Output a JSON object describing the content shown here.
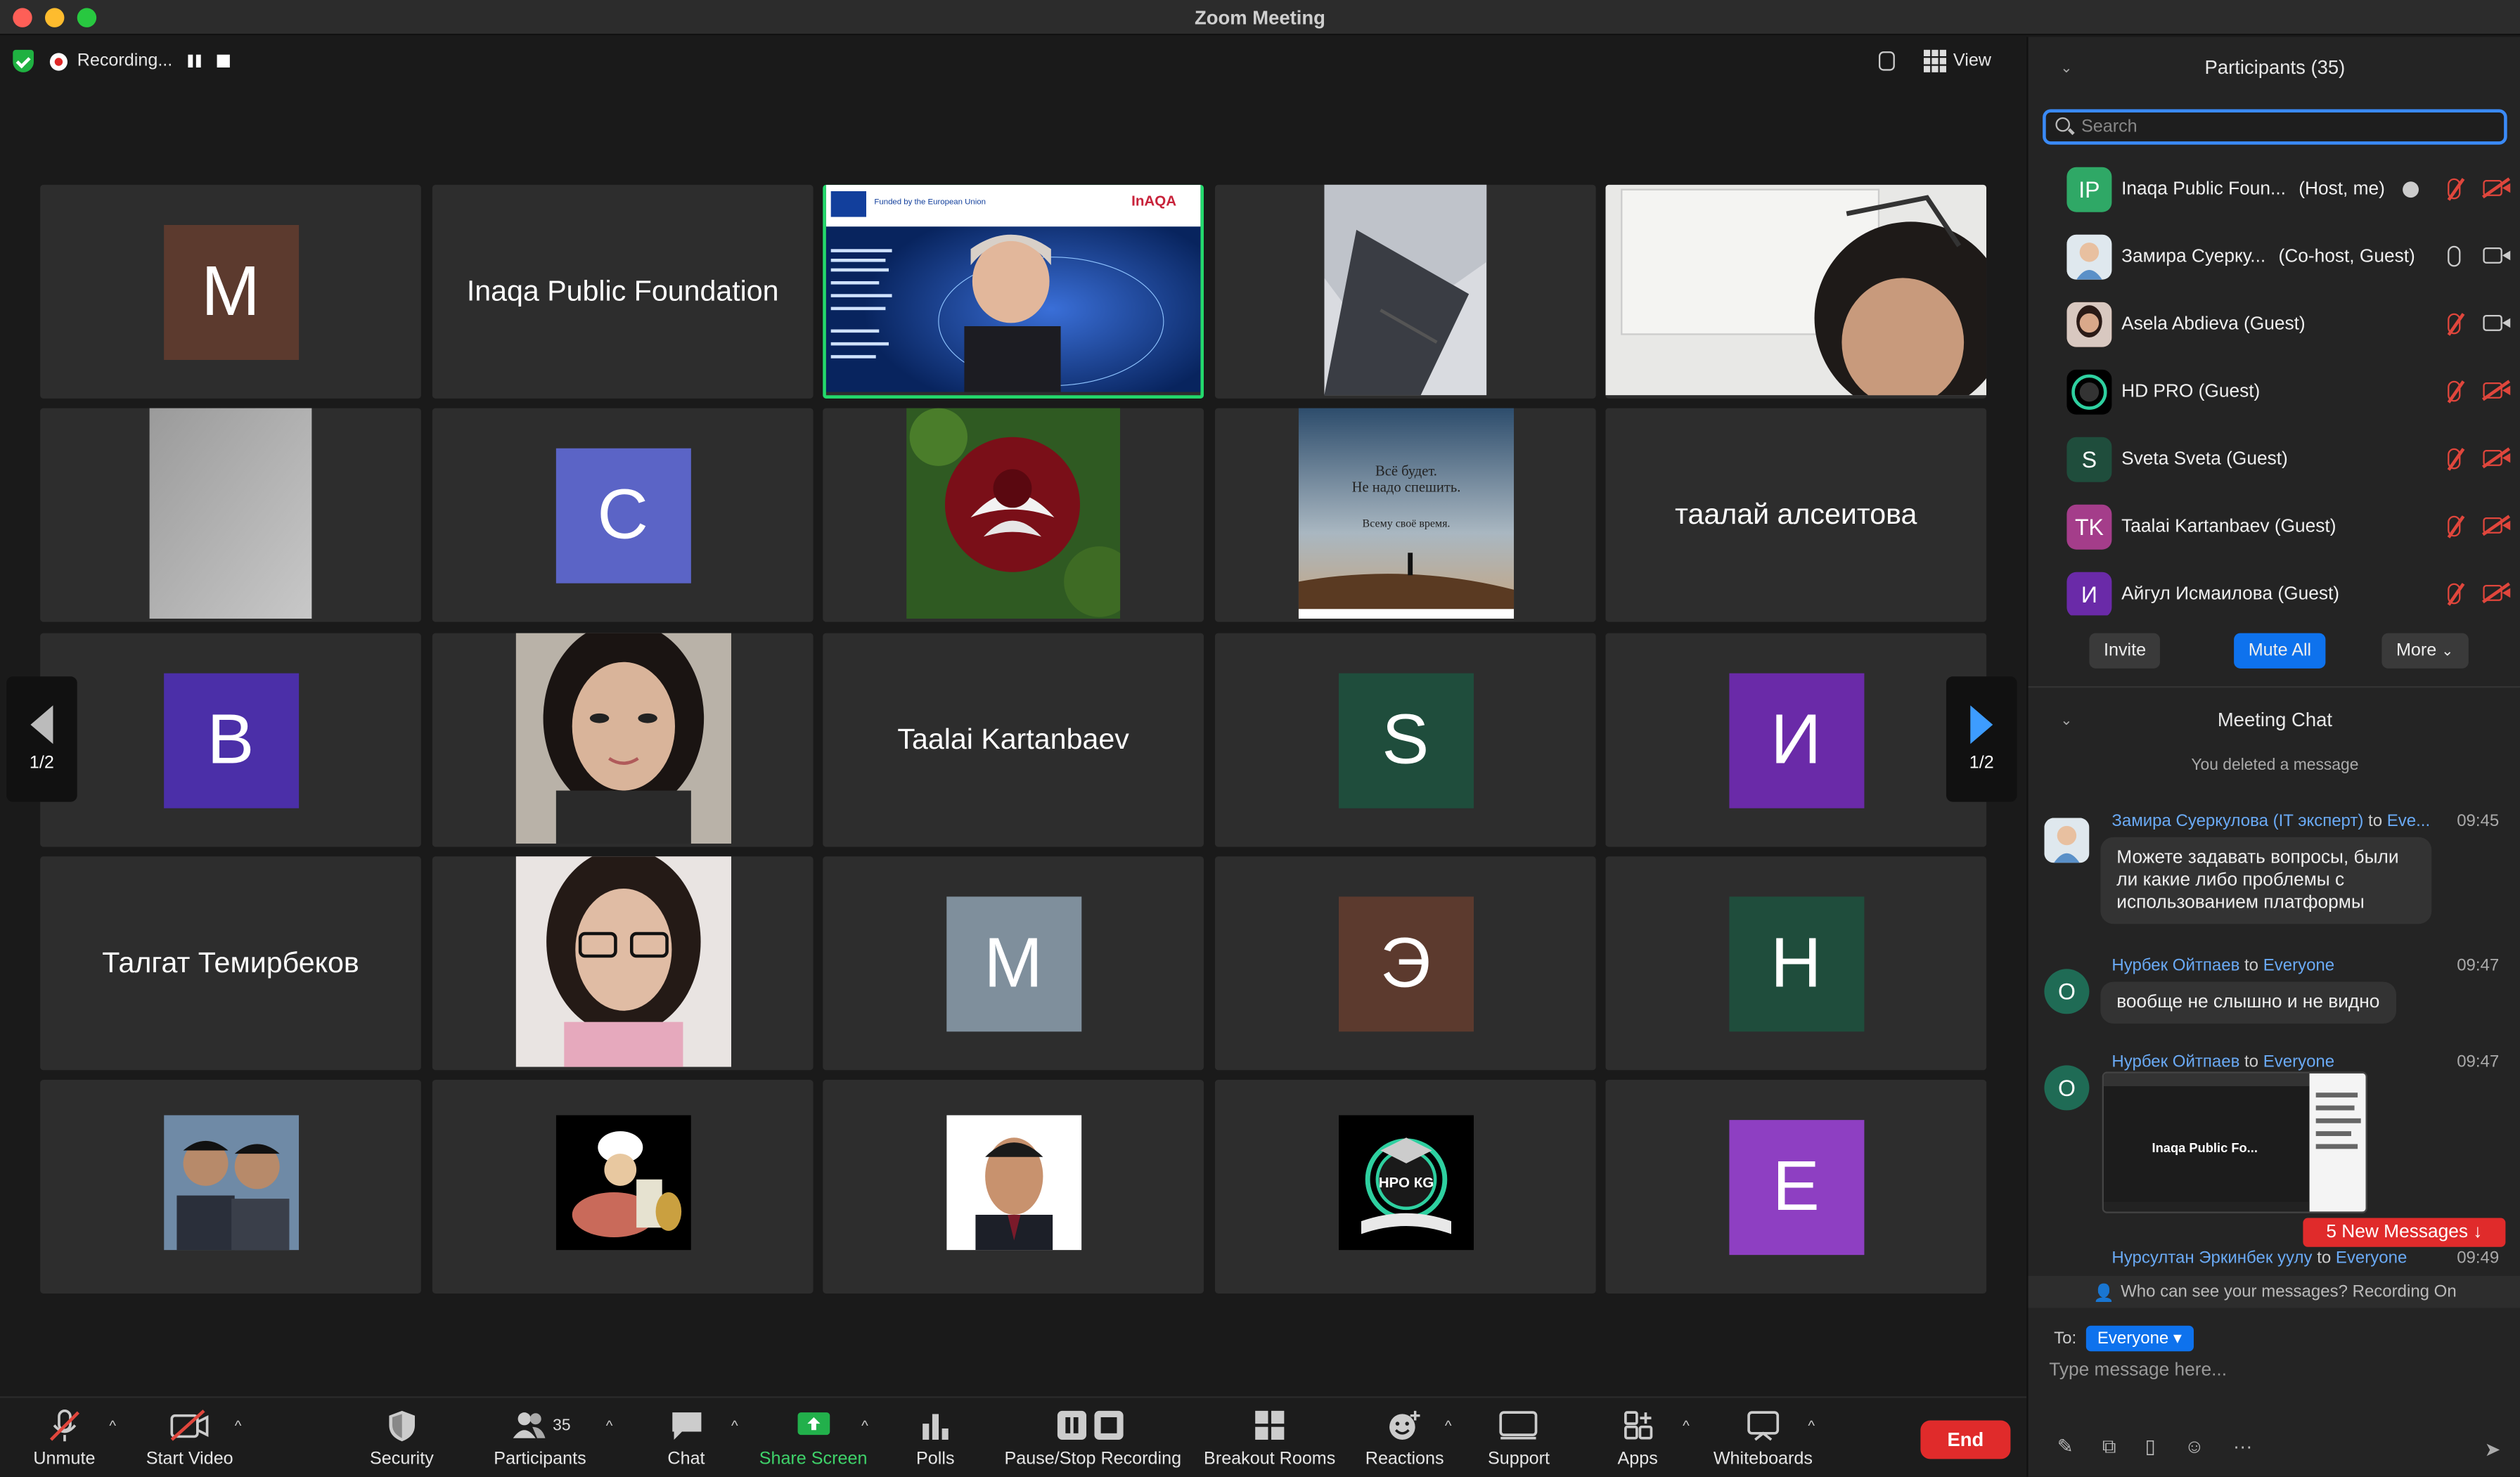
{
  "window": {
    "title": "Zoom Meeting"
  },
  "status": {
    "recording_label": "Recording..."
  },
  "view": {
    "label": "View"
  },
  "pagination": {
    "left": "1/2",
    "right": "1/2"
  },
  "tiles": [
    {
      "type": "avatar",
      "letter": "M",
      "color": "#5c3a2e"
    },
    {
      "type": "name",
      "name": "Inaqa Public Foundation"
    },
    {
      "type": "video",
      "desc": "speaker",
      "active": true
    },
    {
      "type": "video",
      "desc": "fabric"
    },
    {
      "type": "video",
      "desc": "person"
    },
    {
      "type": "video",
      "desc": "blur"
    },
    {
      "type": "avatar",
      "letter": "C",
      "color": "#5b64c6"
    },
    {
      "type": "video",
      "desc": "rose"
    },
    {
      "type": "video",
      "desc": "poster"
    },
    {
      "type": "name",
      "name": "таалай алсеитова"
    },
    {
      "type": "avatar",
      "letter": "B",
      "color": "#4b2fa8"
    },
    {
      "type": "video",
      "desc": "woman1"
    },
    {
      "type": "name",
      "name": "Taalai Kartanbaev"
    },
    {
      "type": "avatar",
      "letter": "S",
      "color": "#1f4d3c"
    },
    {
      "type": "avatar",
      "letter": "И",
      "color": "#6a2aa8"
    },
    {
      "type": "name",
      "name": "Талгат Темирбеков"
    },
    {
      "type": "video",
      "desc": "woman2"
    },
    {
      "type": "avatar",
      "letter": "M",
      "color": "#7f8f9c"
    },
    {
      "type": "avatar",
      "letter": "Э",
      "color": "#5c3a2e"
    },
    {
      "type": "avatar",
      "letter": "H",
      "color": "#1f4d3c"
    },
    {
      "type": "video",
      "desc": "men"
    },
    {
      "type": "video",
      "desc": "chef"
    },
    {
      "type": "video",
      "desc": "portrait"
    },
    {
      "type": "video",
      "desc": "logo"
    },
    {
      "type": "avatar",
      "letter": "E",
      "color": "#8e3fc2"
    }
  ],
  "poster": {
    "line1": "Всё будет.",
    "line2": "Не надо спешить.",
    "line3": "Всему своё время."
  },
  "speaker_slide": {
    "funded": "Funded by the European Union",
    "brand": "InAQA"
  },
  "logo_text": "НРО КG",
  "toolbar": [
    {
      "label": "Unmute",
      "icon": "mic-muted-icon",
      "caret": true
    },
    {
      "label": "Start Video",
      "icon": "video-off-icon",
      "caret": true
    },
    {
      "label": "Security",
      "icon": "shield-icon",
      "caret": false
    },
    {
      "label": "Participants",
      "icon": "participants-icon",
      "count": "35",
      "caret": true
    },
    {
      "label": "Chat",
      "icon": "chat-icon",
      "caret": true
    },
    {
      "label": "Share Screen",
      "icon": "share-screen-icon",
      "caret": true
    },
    {
      "label": "Polls",
      "icon": "polls-icon",
      "caret": false
    },
    {
      "label": "Pause/Stop Recording",
      "icon": "recording-icon",
      "caret": false
    },
    {
      "label": "Breakout Rooms",
      "icon": "breakout-icon",
      "caret": false
    },
    {
      "label": "Reactions",
      "icon": "reactions-icon",
      "caret": true
    },
    {
      "label": "Support",
      "icon": "support-icon",
      "caret": false
    },
    {
      "label": "Apps",
      "icon": "apps-icon",
      "caret": true
    },
    {
      "label": "Whiteboards",
      "icon": "whiteboard-icon",
      "caret": true
    }
  ],
  "end_label": "End",
  "participants_panel": {
    "title": "Participants (35)",
    "search_placeholder": "Search",
    "list": [
      {
        "initials": "IP",
        "color": "#2fa866",
        "name": "Inaqa Public Foun...",
        "role": "(Host, me)",
        "mic": "muted",
        "cam": "muted"
      },
      {
        "initials": "",
        "color": "#cfd8e0",
        "name": "Замира Суерку...",
        "role": "(Co-host, Guest)",
        "mic": "on",
        "cam": "on"
      },
      {
        "initials": "",
        "color": "#8a5a4a",
        "name": "Asela Abdieva (Guest)",
        "role": "",
        "mic": "muted",
        "cam": "on"
      },
      {
        "initials": "",
        "color": "#111111",
        "name": "HD PRO (Guest)",
        "role": "",
        "mic": "muted",
        "cam": "muted"
      },
      {
        "initials": "S",
        "color": "#1f4d3c",
        "name": "Sveta Sveta (Guest)",
        "role": "",
        "mic": "muted",
        "cam": "muted"
      },
      {
        "initials": "TK",
        "color": "#a43d8a",
        "name": "Taalai Kartanbaev (Guest)",
        "role": "",
        "mic": "muted",
        "cam": "muted"
      },
      {
        "initials": "И",
        "color": "#6a2aa8",
        "name": "Айгул Исмаилова (Guest)",
        "role": "",
        "mic": "muted",
        "cam": "muted"
      }
    ],
    "buttons": {
      "invite": "Invite",
      "mute_all": "Mute All",
      "more": "More"
    }
  },
  "chat": {
    "title": "Meeting Chat",
    "note": "You deleted a message",
    "messages": [
      {
        "sender": "Замира Суеркулова (IT эксперт)",
        "to_word": "to",
        "to": "Eve...",
        "time": "09:45",
        "text": "Можете задавать вопросы, были ли какие либо проблемы с использованием платформы"
      },
      {
        "sender": "Нурбек Ойтпаев",
        "to_word": "to",
        "to": "Everyone",
        "time": "09:47",
        "text": "вообще не слышно и не видно"
      },
      {
        "sender": "Нурбек Ойтпаев",
        "to_word": "to",
        "to": "Everyone",
        "time": "09:47",
        "text": ""
      },
      {
        "sender": "Нурсултан Эркинбек уулу",
        "to_word": "to",
        "to": "Everyone",
        "time": "09:49",
        "text": ""
      }
    ],
    "avatar_letter": "O",
    "thumb_caption": "Inaqa Public Fo...",
    "new_messages": "5 New Messages ↓",
    "visibility": "Who can see your messages? Recording On",
    "to_label": "To:",
    "to_value": "Everyone ▾",
    "input_placeholder": "Type message here..."
  }
}
